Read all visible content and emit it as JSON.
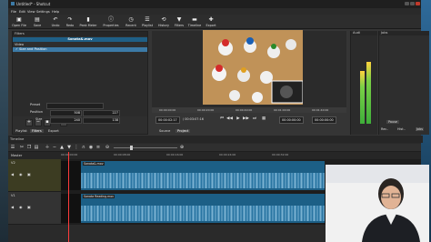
{
  "window": {
    "title": "Untitled* - Shotcut"
  },
  "menu": [
    "File",
    "Edit",
    "View",
    "Settings",
    "Help"
  ],
  "toolbar": [
    {
      "label": "Open File",
      "icon": "folder-icon"
    },
    {
      "label": "Save",
      "icon": "save-icon"
    },
    {
      "label": "Undo",
      "icon": "undo-icon"
    },
    {
      "label": "Redo",
      "icon": "redo-icon"
    },
    {
      "label": "Peak Meter",
      "icon": "meter-icon"
    },
    {
      "label": "Properties",
      "icon": "info-icon"
    },
    {
      "label": "Recent",
      "icon": "clock-icon"
    },
    {
      "label": "Playlist",
      "icon": "list-icon"
    },
    {
      "label": "History",
      "icon": "history-icon"
    },
    {
      "label": "Filters",
      "icon": "filter-icon"
    },
    {
      "label": "Timeline",
      "icon": "timeline-icon"
    },
    {
      "label": "Export",
      "icon": "export-icon"
    }
  ],
  "filters": {
    "header": "Filters",
    "clip_name": "Sonata&.mov",
    "category": "Video",
    "item": "Size and Position",
    "props": {
      "preset_label": "Preset",
      "position_label": "Position",
      "position_x": "508",
      "position_y": "227",
      "size_label": "Size",
      "size_w": "240",
      "size_h": "138"
    },
    "tabs": [
      "Playlist",
      "Filters",
      "Export"
    ]
  },
  "player": {
    "scale_labels": [
      "00:00:00:00",
      "00:00:20:00",
      "00:00:40:00",
      "00:01:00:00",
      "00:01:20:00",
      "00:01:40:00"
    ],
    "timecode_current": "00:00:02:17",
    "timecode_total": "/ 00:03:07:16",
    "timecode_in": "00:00:00:00",
    "timecode_out": "00:00:00:00",
    "tabs": [
      "Source",
      "Project"
    ]
  },
  "audio": {
    "header": "Audi",
    "level_left": 0.72,
    "level_right": 0.85
  },
  "jobs": {
    "header": "Jobs",
    "tabs": [
      "Recent",
      "History",
      "Jobs"
    ],
    "pause": "Pause",
    "pause2": "Rec..",
    "pause3": "Hist.."
  },
  "timeline": {
    "header": "Timeline",
    "master_label": "Master",
    "ruler_labels": [
      "00:00:00:00",
      "00:00:08:00",
      "00:00:16:00",
      "00:00:24:00",
      "00:00:32:00",
      "00:00:40:00",
      "00:00:48:00"
    ],
    "tracks": [
      {
        "name": "V2",
        "clip": "Sonata&.mov"
      },
      {
        "name": "V1",
        "clip": "Sonata Reading.mov"
      }
    ]
  },
  "colors": {
    "accent": "#1f5f86",
    "clip": "#1c5f86",
    "playhead": "#ff3b3b"
  }
}
